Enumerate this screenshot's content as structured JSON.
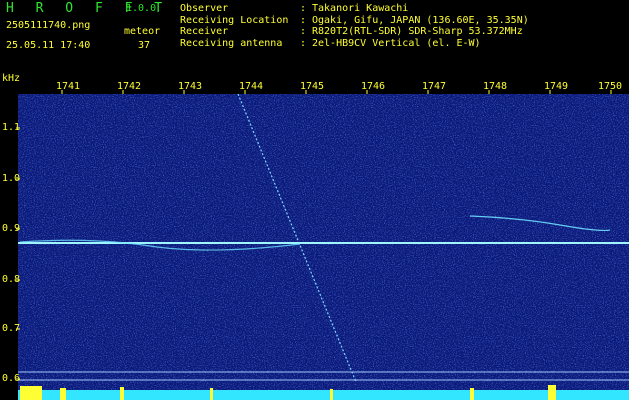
{
  "header": {
    "brand": "H R O F F T",
    "version": "1.0.0",
    "filename": "2505111740.png",
    "datetime": "25.05.11 17:40",
    "meteor_label": "meteor",
    "meteor_count": "37"
  },
  "info": [
    {
      "key": "Observer",
      "value": "Takanori Kawachi"
    },
    {
      "key": "Receiving Location",
      "value": "Ogaki, Gifu, JAPAN (136.60E, 35.35N)"
    },
    {
      "key": "Receiver",
      "value": "R820T2(RTL-SDR) SDR-Sharp 53.372MHz"
    },
    {
      "key": "Receiving antenna",
      "value": "2el-HB9CV Vertical (el. E-W)"
    }
  ],
  "axis": {
    "y_unit": "kHz",
    "x_ticks": [
      "1741",
      "1742",
      "1743",
      "1744",
      "1745",
      "1746",
      "1747",
      "1748",
      "1749",
      "1750"
    ],
    "y_ticks": [
      "1.1",
      "1.0",
      "0.9",
      "0.8",
      "0.7",
      "0.6"
    ]
  },
  "colors": {
    "background": "#000000",
    "header_text": "#ffff33",
    "brand": "#2ee62e",
    "spectrogram": "#0a1a7a",
    "trace": "#8ff0ff",
    "level_bar": "#33e6ff"
  }
}
